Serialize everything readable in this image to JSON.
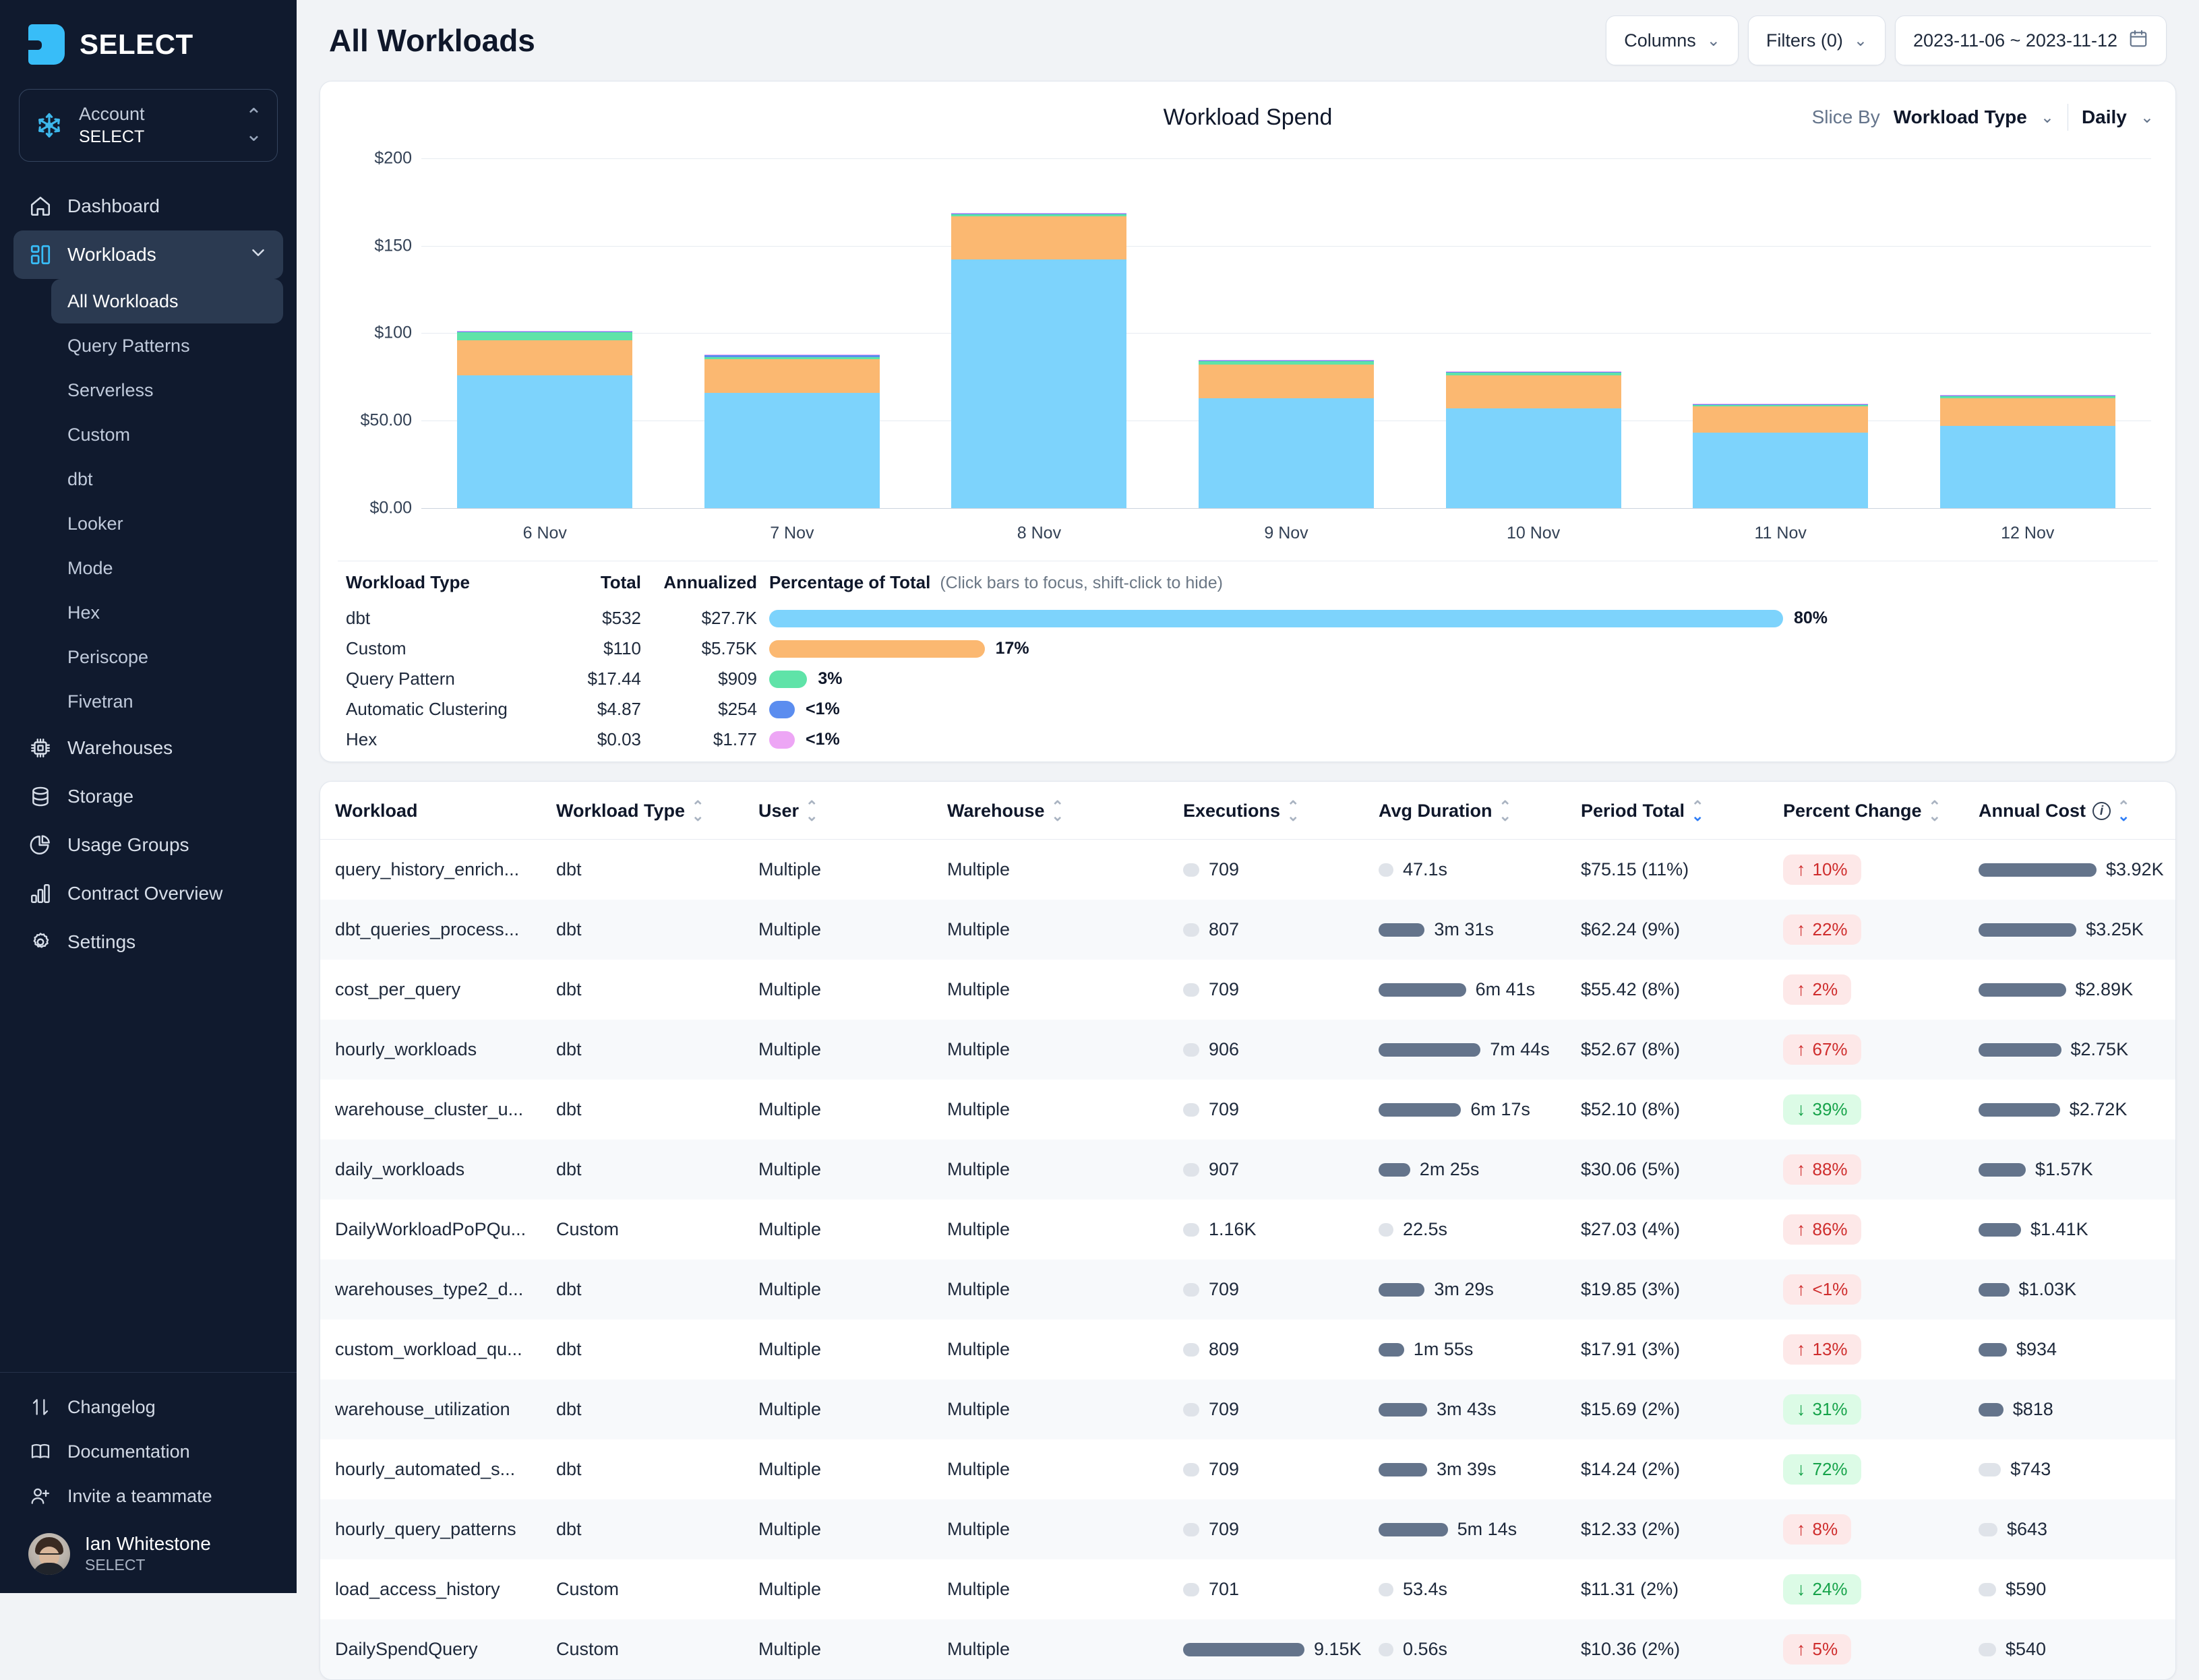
{
  "brand": {
    "name": "SELECT"
  },
  "account": {
    "label": "Account",
    "value": "SELECT"
  },
  "sidebar": {
    "items": [
      {
        "label": "Dashboard",
        "icon": "home-icon"
      },
      {
        "label": "Workloads",
        "icon": "workloads-icon"
      }
    ],
    "sub_items": [
      {
        "label": "All Workloads"
      },
      {
        "label": "Query Patterns"
      },
      {
        "label": "Serverless"
      },
      {
        "label": "Custom"
      },
      {
        "label": "dbt"
      },
      {
        "label": "Looker"
      },
      {
        "label": "Mode"
      },
      {
        "label": "Hex"
      },
      {
        "label": "Periscope"
      },
      {
        "label": "Fivetran"
      }
    ],
    "lower_items": [
      {
        "label": "Warehouses",
        "icon": "chip-icon"
      },
      {
        "label": "Storage",
        "icon": "database-icon"
      },
      {
        "label": "Usage Groups",
        "icon": "pie-chart-icon"
      },
      {
        "label": "Contract Overview",
        "icon": "bar-chart-icon"
      },
      {
        "label": "Settings",
        "icon": "gear-icon"
      }
    ],
    "footer_items": [
      {
        "label": "Changelog",
        "icon": "updown-arrows-icon"
      },
      {
        "label": "Documentation",
        "icon": "book-icon"
      },
      {
        "label": "Invite a teammate",
        "icon": "user-plus-icon"
      }
    ],
    "user": {
      "name": "Ian Whitestone",
      "org": "SELECT"
    }
  },
  "header": {
    "title": "All Workloads",
    "columns_button": "Columns",
    "filters_button": "Filters (0)",
    "date_range": "2023-11-06 ~ 2023-11-12"
  },
  "chart_panel": {
    "slice_by_label": "Slice By",
    "slice_by_value": "Workload Type",
    "granularity": "Daily"
  },
  "legend": {
    "headers": {
      "type": "Workload Type",
      "total": "Total",
      "annualized": "Annualized",
      "percentage": "Percentage of Total",
      "hint": "(Click bars to focus, shift-click to hide)"
    },
    "rows": [
      {
        "type": "dbt",
        "total": "$532",
        "annualized": "$27.7K",
        "pct_label": "80%",
        "pct": 80,
        "color": "#7dd3fc"
      },
      {
        "type": "Custom",
        "total": "$110",
        "annualized": "$5.75K",
        "pct_label": "17%",
        "pct": 17,
        "color": "#fbb871"
      },
      {
        "type": "Query Pattern",
        "total": "$17.44",
        "annualized": "$909",
        "pct_label": "3%",
        "pct": 3,
        "color": "#5fe3a8"
      },
      {
        "type": "Automatic Clustering",
        "total": "$4.87",
        "annualized": "$254",
        "pct_label": "<1%",
        "pct": 1.6,
        "color": "#5b8def"
      },
      {
        "type": "Hex",
        "total": "$0.03",
        "annualized": "$1.77",
        "pct_label": "<1%",
        "pct": 1.6,
        "color": "#eda6f5"
      }
    ]
  },
  "chart_data": {
    "type": "bar",
    "title": "Workload Spend",
    "xlabel": "",
    "ylabel": "",
    "ylim": [
      0,
      210
    ],
    "grid": true,
    "stacked": true,
    "legend_position": "below-as-table",
    "ytick_labels": [
      "$200",
      "$150",
      "$100",
      "$50.00",
      "$0.00"
    ],
    "ytick_values": [
      200,
      150,
      100,
      50,
      0
    ],
    "categories": [
      "6 Nov",
      "7 Nov",
      "8 Nov",
      "9 Nov",
      "10 Nov",
      "11 Nov",
      "12 Nov"
    ],
    "series": [
      {
        "name": "dbt",
        "color": "#7dd3fc",
        "values": [
          76,
          66,
          142,
          63,
          57,
          43,
          47
        ]
      },
      {
        "name": "Custom",
        "color": "#fbb871",
        "values": [
          20,
          19,
          25,
          19,
          19,
          15,
          16
        ]
      },
      {
        "name": "Query Pattern",
        "color": "#5fe3a8",
        "values": [
          4.5,
          1.2,
          1.0,
          2.0,
          1.5,
          1.0,
          1.0
        ]
      },
      {
        "name": "Automatic Clustering",
        "color": "#5b8def",
        "values": [
          0.6,
          1.4,
          0.5,
          0.5,
          0.5,
          0.5,
          0.5
        ]
      },
      {
        "name": "Hex",
        "color": "#eda6f5",
        "values": [
          0.4,
          0.2,
          0.2,
          0.2,
          0.2,
          0.2,
          0.2
        ]
      }
    ],
    "totals": [
      101.5,
      87.8,
      168.7,
      84.7,
      78.2,
      59.7,
      64.7
    ]
  },
  "table": {
    "columns": [
      {
        "key": "workload",
        "label": "Workload",
        "sortable": false
      },
      {
        "key": "workload_type",
        "label": "Workload Type",
        "sortable": true
      },
      {
        "key": "user",
        "label": "User",
        "sortable": true
      },
      {
        "key": "warehouse",
        "label": "Warehouse",
        "sortable": true
      },
      {
        "key": "executions",
        "label": "Executions",
        "sortable": true
      },
      {
        "key": "avg_duration",
        "label": "Avg Duration",
        "sortable": true
      },
      {
        "key": "period_total",
        "label": "Period Total",
        "sortable": true,
        "sort": "desc"
      },
      {
        "key": "percent_change",
        "label": "Percent Change",
        "sortable": true
      },
      {
        "key": "annual_cost",
        "label": "Annual Cost",
        "sortable": true,
        "sort": "desc",
        "info": true
      }
    ],
    "rows": [
      {
        "workload": "query_history_enrich...",
        "workload_type": "dbt",
        "user": "Multiple",
        "warehouse": "Multiple",
        "executions": "709",
        "exec_bar": 5,
        "avg_duration": "47.1s",
        "dur_bar": 5,
        "period_total": "$75.15 (11%)",
        "percent_change": "10%",
        "direction": "up",
        "annual_cost": "$3.92K",
        "cost_bar": 100
      },
      {
        "workload": "dbt_queries_process...",
        "workload_type": "dbt",
        "user": "Multiple",
        "warehouse": "Multiple",
        "executions": "807",
        "exec_bar": 6,
        "avg_duration": "3m 31s",
        "dur_bar": 38,
        "period_total": "$62.24 (9%)",
        "percent_change": "22%",
        "direction": "up",
        "annual_cost": "$3.25K",
        "cost_bar": 83
      },
      {
        "workload": "cost_per_query",
        "workload_type": "dbt",
        "user": "Multiple",
        "warehouse": "Multiple",
        "executions": "709",
        "exec_bar": 5,
        "avg_duration": "6m 41s",
        "dur_bar": 72,
        "period_total": "$55.42 (8%)",
        "percent_change": "2%",
        "direction": "up",
        "annual_cost": "$2.89K",
        "cost_bar": 74
      },
      {
        "workload": "hourly_workloads",
        "workload_type": "dbt",
        "user": "Multiple",
        "warehouse": "Multiple",
        "executions": "906",
        "exec_bar": 7,
        "avg_duration": "7m 44s",
        "dur_bar": 84,
        "period_total": "$52.67 (8%)",
        "percent_change": "67%",
        "direction": "up",
        "annual_cost": "$2.75K",
        "cost_bar": 70
      },
      {
        "workload": "warehouse_cluster_u...",
        "workload_type": "dbt",
        "user": "Multiple",
        "warehouse": "Multiple",
        "executions": "709",
        "exec_bar": 5,
        "avg_duration": "6m 17s",
        "dur_bar": 68,
        "period_total": "$52.10 (8%)",
        "percent_change": "39%",
        "direction": "down",
        "annual_cost": "$2.72K",
        "cost_bar": 69
      },
      {
        "workload": "daily_workloads",
        "workload_type": "dbt",
        "user": "Multiple",
        "warehouse": "Multiple",
        "executions": "907",
        "exec_bar": 7,
        "avg_duration": "2m 25s",
        "dur_bar": 26,
        "period_total": "$30.06 (5%)",
        "percent_change": "88%",
        "direction": "up",
        "annual_cost": "$1.57K",
        "cost_bar": 40
      },
      {
        "workload": "DailyWorkloadPoPQu...",
        "workload_type": "Custom",
        "user": "Multiple",
        "warehouse": "Multiple",
        "executions": "1.16K",
        "exec_bar": 10,
        "avg_duration": "22.5s",
        "dur_bar": 4,
        "period_total": "$27.03 (4%)",
        "percent_change": "86%",
        "direction": "up",
        "annual_cost": "$1.41K",
        "cost_bar": 36
      },
      {
        "workload": "warehouses_type2_d...",
        "workload_type": "dbt",
        "user": "Multiple",
        "warehouse": "Multiple",
        "executions": "709",
        "exec_bar": 5,
        "avg_duration": "3m 29s",
        "dur_bar": 38,
        "period_total": "$19.85 (3%)",
        "percent_change": "<1%",
        "direction": "up",
        "annual_cost": "$1.03K",
        "cost_bar": 26
      },
      {
        "workload": "custom_workload_qu...",
        "workload_type": "dbt",
        "user": "Multiple",
        "warehouse": "Multiple",
        "executions": "809",
        "exec_bar": 6,
        "avg_duration": "1m 55s",
        "dur_bar": 21,
        "period_total": "$17.91 (3%)",
        "percent_change": "13%",
        "direction": "up",
        "annual_cost": "$934",
        "cost_bar": 24
      },
      {
        "workload": "warehouse_utilization",
        "workload_type": "dbt",
        "user": "Multiple",
        "warehouse": "Multiple",
        "executions": "709",
        "exec_bar": 5,
        "avg_duration": "3m 43s",
        "dur_bar": 40,
        "period_total": "$15.69 (2%)",
        "percent_change": "31%",
        "direction": "down",
        "annual_cost": "$818",
        "cost_bar": 21
      },
      {
        "workload": "hourly_automated_s...",
        "workload_type": "dbt",
        "user": "Multiple",
        "warehouse": "Multiple",
        "executions": "709",
        "exec_bar": 5,
        "avg_duration": "3m 39s",
        "dur_bar": 40,
        "period_total": "$14.24 (2%)",
        "percent_change": "72%",
        "direction": "down",
        "annual_cost": "$743",
        "cost_bar": 19
      },
      {
        "workload": "hourly_query_patterns",
        "workload_type": "dbt",
        "user": "Multiple",
        "warehouse": "Multiple",
        "executions": "709",
        "exec_bar": 5,
        "avg_duration": "5m 14s",
        "dur_bar": 57,
        "period_total": "$12.33 (2%)",
        "percent_change": "8%",
        "direction": "up",
        "annual_cost": "$643",
        "cost_bar": 16
      },
      {
        "workload": "load_access_history",
        "workload_type": "Custom",
        "user": "Multiple",
        "warehouse": "Multiple",
        "executions": "701",
        "exec_bar": 5,
        "avg_duration": "53.4s",
        "dur_bar": 6,
        "period_total": "$11.31 (2%)",
        "percent_change": "24%",
        "direction": "down",
        "annual_cost": "$590",
        "cost_bar": 15
      },
      {
        "workload": "DailySpendQuery",
        "workload_type": "Custom",
        "user": "Multiple",
        "warehouse": "Multiple",
        "executions": "9.15K",
        "exec_bar": 100,
        "avg_duration": "0.56s",
        "dur_bar": 2,
        "period_total": "$10.36 (2%)",
        "percent_change": "5%",
        "direction": "up",
        "annual_cost": "$540",
        "cost_bar": 14
      }
    ]
  }
}
